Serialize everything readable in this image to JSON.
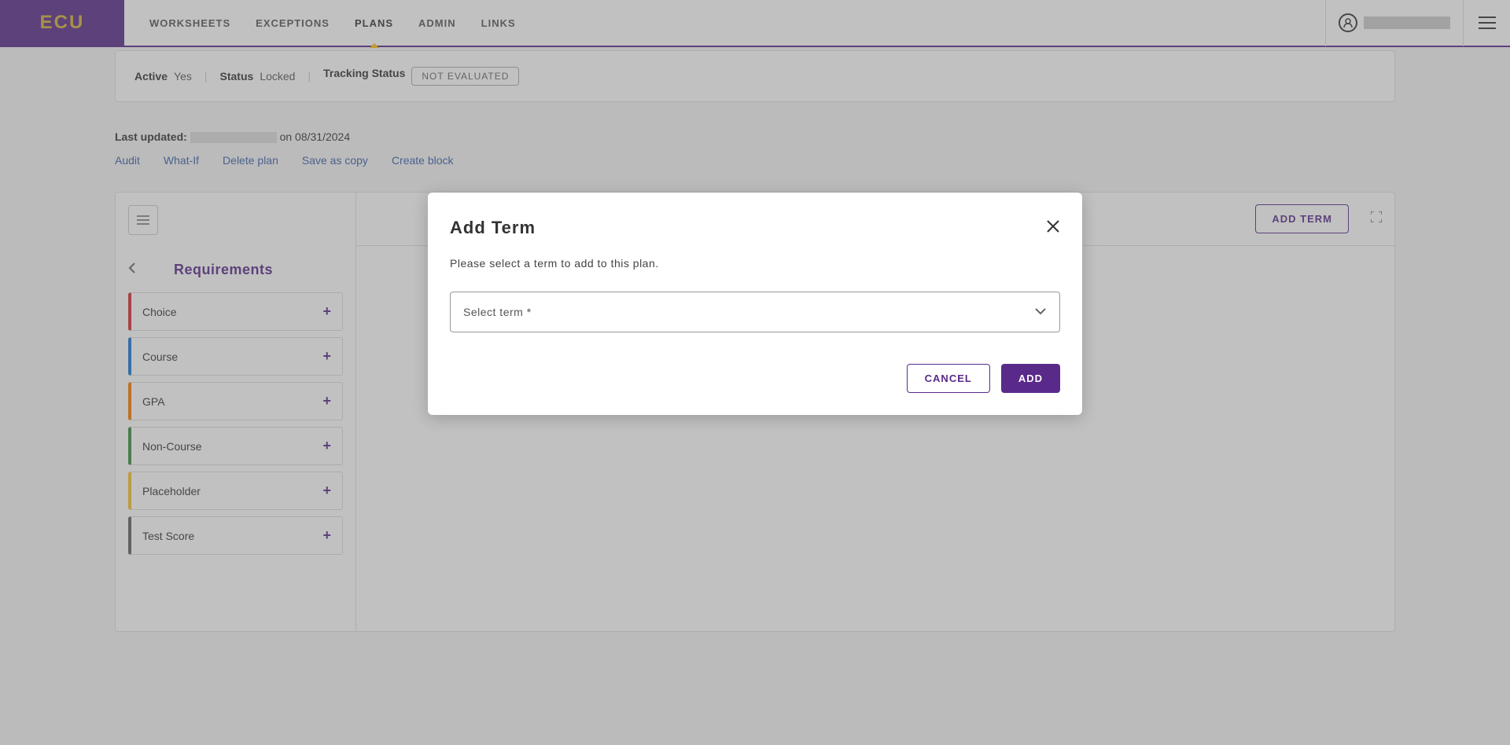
{
  "brand": "ECU",
  "nav": {
    "worksheets": "WORKSHEETS",
    "exceptions": "EXCEPTIONS",
    "plans": "PLANS",
    "admin": "ADMIN",
    "links": "LINKS"
  },
  "status": {
    "active_label": "Active",
    "active_value": "Yes",
    "status_label": "Status",
    "status_value": "Locked",
    "tracking_label": "Tracking Status",
    "tracking_badge": "NOT EVALUATED"
  },
  "updated": {
    "label": "Last updated:",
    "on": "on",
    "date": "08/31/2024"
  },
  "actions": {
    "audit": "Audit",
    "whatif": "What-If",
    "delete": "Delete plan",
    "save_copy": "Save as copy",
    "create_block": "Create block"
  },
  "sidebar": {
    "title": "Requirements",
    "items": [
      {
        "label": "Choice",
        "color": "#d32f2f"
      },
      {
        "label": "Course",
        "color": "#1976d2"
      },
      {
        "label": "GPA",
        "color": "#f57c00"
      },
      {
        "label": "Non-Course",
        "color": "#388e3c"
      },
      {
        "label": "Placeholder",
        "color": "#fbc02d"
      },
      {
        "label": "Test Score",
        "color": "#616161"
      }
    ]
  },
  "toolbar": {
    "add_term": "ADD TERM"
  },
  "modal": {
    "title": "Add Term",
    "subtitle": "Please select a term to add to this plan.",
    "select_placeholder": "Select term *",
    "cancel": "CANCEL",
    "add": "ADD"
  }
}
